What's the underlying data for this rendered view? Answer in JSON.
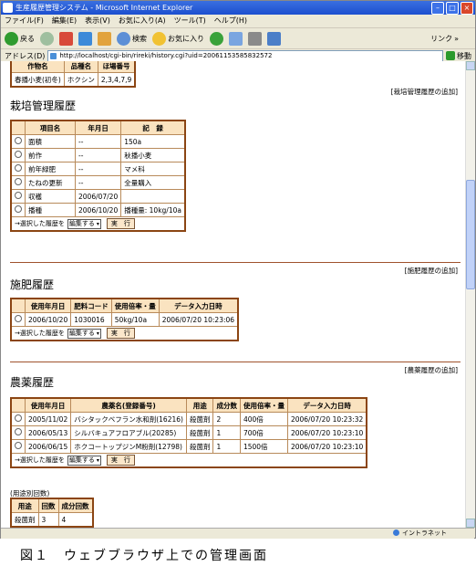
{
  "window": {
    "title": "生産履歴管理システム - Microsoft Internet Explorer"
  },
  "menu": [
    "ファイル(F)",
    "編集(E)",
    "表示(V)",
    "お気に入り(A)",
    "ツール(T)",
    "ヘルプ(H)"
  ],
  "toolbar": {
    "back": "戻る",
    "search": "検索",
    "favorites": "お気に入り",
    "links": "リンク"
  },
  "address": {
    "label": "アドレス(D)",
    "url": "http://localhost/cgi-bin/rireki/history.cgi?uid=20061153585832572",
    "go": "移動"
  },
  "top_table": {
    "headers": [
      "作物名",
      "品種名",
      "ほ場番号"
    ],
    "row": [
      "春播小麦(初冬)",
      "ホクシン",
      "2,3,4,7,9"
    ]
  },
  "cultivation": {
    "title": "栽培管理履歴",
    "add_link": "[栽培管理履歴の追加]",
    "headers": [
      "項目名",
      "年月日",
      "記　録"
    ],
    "rows": [
      [
        "面積",
        "--",
        "150a"
      ],
      [
        "前作",
        "--",
        "秋播小麦"
      ],
      [
        "前年緑肥",
        "--",
        "マメ科"
      ],
      [
        "たねの更新",
        "--",
        "全量購入"
      ],
      [
        "収穫",
        "2006/07/20",
        ""
      ],
      [
        "播種",
        "2006/10/20",
        "播種量: 10kg/10a"
      ]
    ]
  },
  "fertilizer": {
    "title": "施肥履歴",
    "add_link": "[施肥履歴の追加]",
    "headers": [
      "使用年月日",
      "肥料コード",
      "使用倍率・量",
      "データ入力日時"
    ],
    "rows": [
      [
        "2006/10/20",
        "1030016",
        "50kg/10a",
        "2006/07/20 10:23:06"
      ]
    ]
  },
  "pesticide": {
    "title": "農薬履歴",
    "add_link": "[農薬履歴の追加]",
    "headers": [
      "使用年月日",
      "農薬名(登録番号)",
      "用途",
      "成分数",
      "使用倍率・量",
      "データ入力日時"
    ],
    "rows": [
      [
        "2005/11/02",
        "バシタックベフラン水和剤(16216)",
        "殺菌剤",
        "2",
        "400倍",
        "2006/07/20 10:23:32"
      ],
      [
        "2006/05/13",
        "シルバキュアフロアブル(20285)",
        "殺菌剤",
        "1",
        "700倍",
        "2006/07/20 10:23:10"
      ],
      [
        "2006/06/15",
        "ホクコートップジンM粉剤(12798)",
        "殺菌剤",
        "1",
        "1500倍",
        "2006/07/20 10:23:10"
      ]
    ]
  },
  "action": {
    "prefix": "→選択した履歴を",
    "select_value": "編集する",
    "run": "実　行"
  },
  "usage_count": {
    "caption": "(用途別回数)",
    "headers": [
      "用途",
      "回数",
      "成分回数"
    ],
    "row": [
      "殺菌剤",
      "3",
      "4"
    ]
  },
  "status": {
    "zone": "イントラネット"
  },
  "caption": "図１　ウェブブラウザ上での管理画面"
}
